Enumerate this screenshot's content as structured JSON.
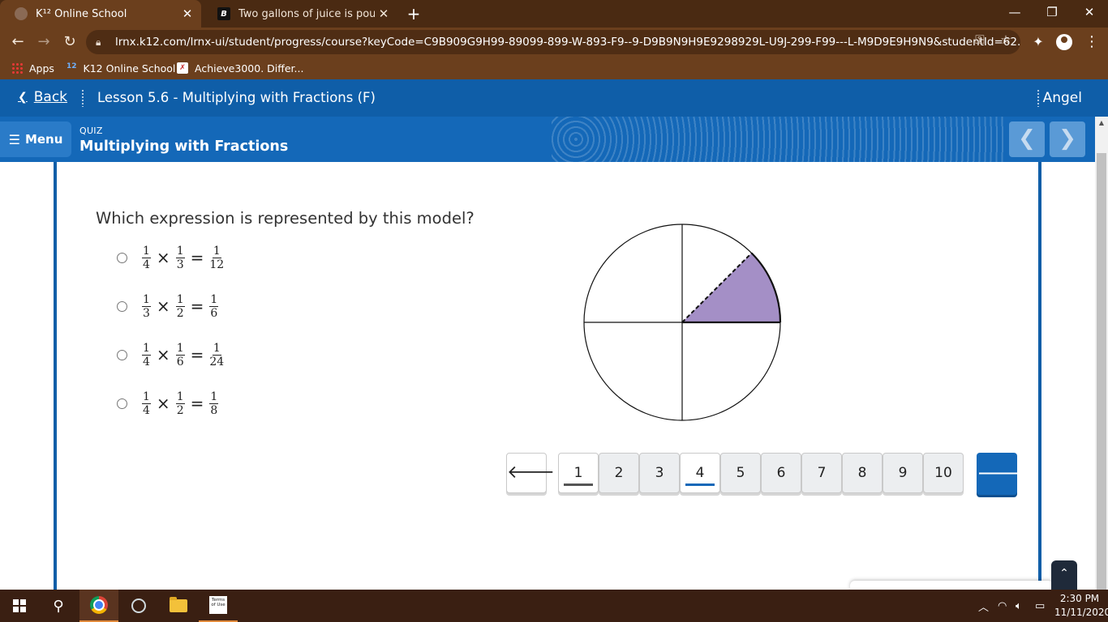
{
  "browser": {
    "tabs": [
      {
        "title": "K¹² Online School",
        "active": true
      },
      {
        "title": "Two gallons of juice is poured int",
        "active": false
      }
    ],
    "url": "lrnx.k12.com/lrnx-ui/student/progress/course?keyCode=C9B909G9H99-89099-899-W-893-F9--9-D9B9N9H9E9298929L-U9J-299-F99---L-M9D9E9H9N9&studentId=62...",
    "bookmarks": [
      {
        "label": "Apps"
      },
      {
        "label": "K12 Online School",
        "badge": "12"
      },
      {
        "label": "Achieve3000. Differ..."
      }
    ]
  },
  "header": {
    "back_label": "Back",
    "lesson_title": "Lesson 5.6 - Multiplying with Fractions (F)",
    "student_name": "Angel"
  },
  "quiz_bar": {
    "menu_label": "Menu",
    "section_label": "QUIZ",
    "title": "Multiplying with Fractions"
  },
  "question": {
    "prompt": "Which expression is represented by this model?",
    "choices": [
      {
        "a": {
          "num": "1",
          "den": "4"
        },
        "b": {
          "num": "1",
          "den": "3"
        },
        "r": {
          "num": "1",
          "den": "12"
        }
      },
      {
        "a": {
          "num": "1",
          "den": "3"
        },
        "b": {
          "num": "1",
          "den": "2"
        },
        "r": {
          "num": "1",
          "den": "6"
        }
      },
      {
        "a": {
          "num": "1",
          "den": "4"
        },
        "b": {
          "num": "1",
          "den": "6"
        },
        "r": {
          "num": "1",
          "den": "24"
        }
      },
      {
        "a": {
          "num": "1",
          "den": "4"
        },
        "b": {
          "num": "1",
          "den": "2"
        },
        "r": {
          "num": "1",
          "den": "8"
        }
      }
    ],
    "operator_times": "×",
    "operator_equals": "="
  },
  "model": {
    "description_fraction_of_circle_shaded": 0.0833,
    "shade_color": "#a48fc6"
  },
  "pagination": {
    "pages": [
      "1",
      "2",
      "3",
      "4",
      "5",
      "6",
      "7",
      "8",
      "9",
      "10"
    ],
    "current": "4",
    "visited": [
      "1",
      "4"
    ],
    "prev_icon": "arrow-left-icon",
    "next_icon": "arrow-right-icon"
  },
  "colors": {
    "primary": "#0f5ea8",
    "quiz_bar": "#1468b8",
    "browser_frame": "#6b3f1d",
    "current_page_mark": "#1468b8",
    "visited_page_mark": "#555555"
  },
  "taskbar": {
    "time": "2:30 PM",
    "date": "11/11/2020",
    "terms_icon_text": "Terms of Use"
  }
}
